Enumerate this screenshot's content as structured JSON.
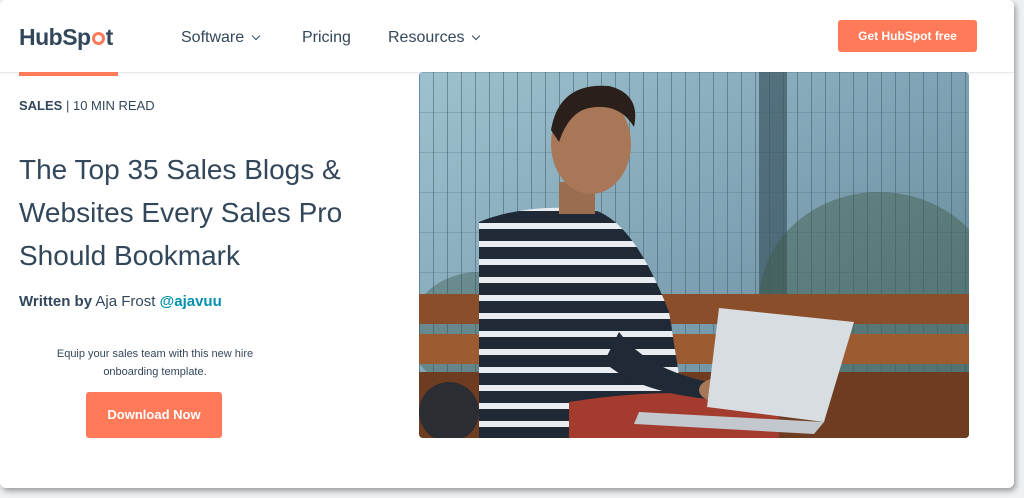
{
  "brand": {
    "logo_left": "HubSp",
    "logo_right": "t",
    "accent_color": "#ff7a59",
    "text_color": "#33475b"
  },
  "nav": {
    "items": [
      {
        "label": "Software",
        "has_dropdown": true
      },
      {
        "label": "Pricing",
        "has_dropdown": false
      },
      {
        "label": "Resources",
        "has_dropdown": true
      }
    ],
    "cta_label": "Get HubSpot free"
  },
  "article": {
    "category": "SALES",
    "separator": "|",
    "read_time": "10 MIN READ",
    "title": "The Top 35 Sales Blogs & Websites Every Sales Pro Should Bookmark",
    "byline_label": "Written by",
    "author": "Aja Frost",
    "author_handle": "@ajavuu"
  },
  "promo": {
    "text": "Equip your sales team with this new hire onboarding template.",
    "button_label": "Download Now"
  },
  "hero_image": {
    "icon": "photo-man-laptop-bench"
  }
}
